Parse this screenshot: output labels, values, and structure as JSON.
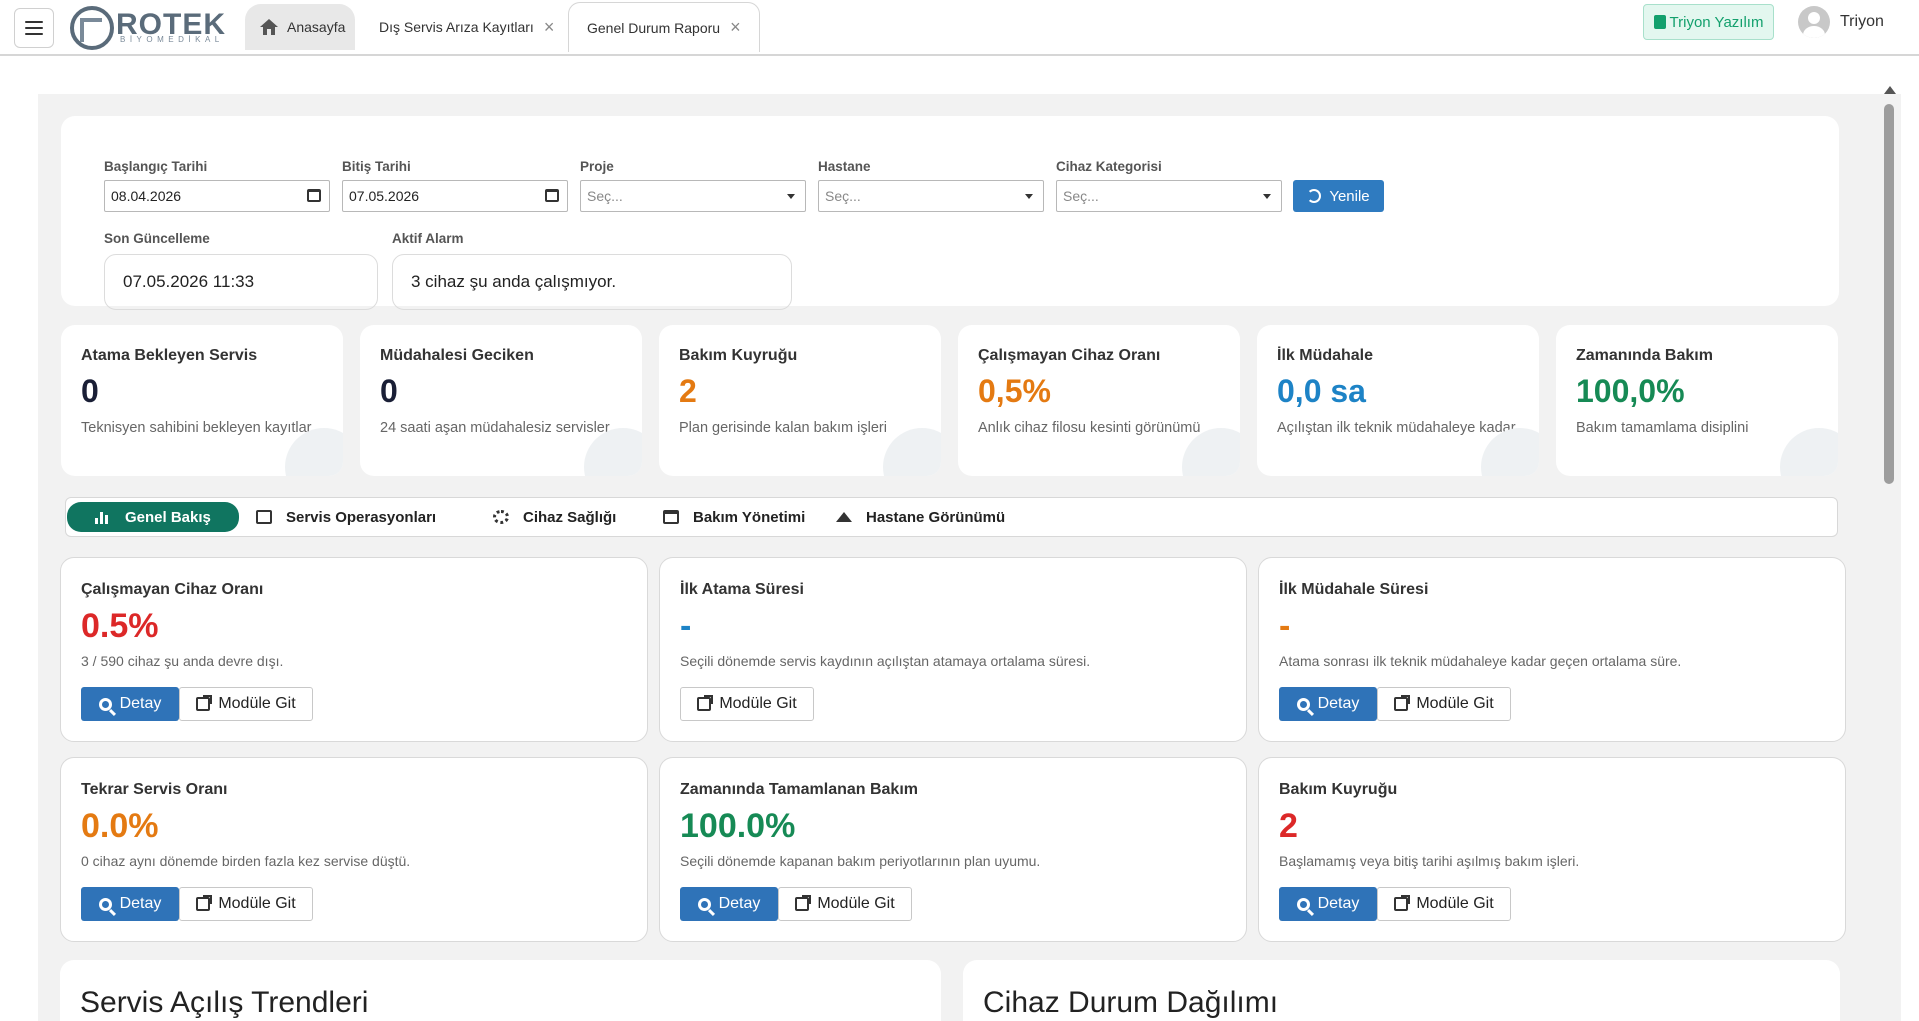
{
  "header": {
    "logo_text": "ROTEK",
    "logo_sub": "BİYOMEDİKAL",
    "tabs": [
      {
        "label": "Anasayfa"
      },
      {
        "label": "Dış Servis Arıza Kayıtları"
      },
      {
        "label": "Genel Durum Raporu"
      }
    ],
    "brand_button": "Triyon Yazılım",
    "user_name": "Triyon"
  },
  "filters": {
    "start_label": "Başlangıç Tarihi",
    "start_value": "08.04.2026",
    "end_label": "Bitiş Tarihi",
    "end_value": "07.05.2026",
    "project_label": "Proje",
    "project_placeholder": "Seç...",
    "hospital_label": "Hastane",
    "hospital_placeholder": "Seç...",
    "category_label": "Cihaz Kategorisi",
    "category_placeholder": "Seç...",
    "refresh_label": "Yenile",
    "last_update_label": "Son Güncelleme",
    "last_update_value": "07.05.2026 11:33",
    "alarm_label": "Aktif Alarm",
    "alarm_value": "3 cihaz şu anda çalışmıyor."
  },
  "kpis": [
    {
      "title": "Atama Bekleyen Servis",
      "value": "0",
      "desc": "Teknisyen sahibini bekleyen kayıtlar"
    },
    {
      "title": "Müdahalesi Geciken",
      "value": "0",
      "desc": "24 saati aşan müdahalesiz servisler"
    },
    {
      "title": "Bakım Kuyruğu",
      "value": "2",
      "desc": "Plan gerisinde kalan bakım işleri"
    },
    {
      "title": "Çalışmayan Cihaz Oranı",
      "value": "0,5%",
      "desc": "Anlık cihaz filosu kesinti görünümü"
    },
    {
      "title": "İlk Müdahale",
      "value": "0,0 sa",
      "desc": "Açılıştan ilk teknik müdahaleye kadar"
    },
    {
      "title": "Zamanında Bakım",
      "value": "100,0%",
      "desc": "Bakım tamamlama disiplini"
    }
  ],
  "section_tabs": [
    {
      "label": "Genel Bakış"
    },
    {
      "label": "Servis Operasyonları"
    },
    {
      "label": "Cihaz Sağlığı"
    },
    {
      "label": "Bakım Yönetimi"
    },
    {
      "label": "Hastane Görünümü"
    }
  ],
  "buttons": {
    "detay": "Detay",
    "git": "Modüle Git"
  },
  "metrics": [
    {
      "title": "Çalışmayan Cihaz Oranı",
      "value": "0.5%",
      "desc": "3 / 590 cihaz şu anda devre dışı."
    },
    {
      "title": "İlk Atama Süresi",
      "value": "-",
      "desc": "Seçili dönemde servis kaydının açılıştan atamaya ortalama süresi."
    },
    {
      "title": "İlk Müdahale Süresi",
      "value": "-",
      "desc": "Atama sonrası ilk teknik müdahaleye kadar geçen ortalama süre."
    },
    {
      "title": "Tekrar Servis Oranı",
      "value": "0.0%",
      "desc": "0 cihaz aynı dönemde birden fazla kez servise düştü."
    },
    {
      "title": "Zamanında Tamamlanan Bakım",
      "value": "100.0%",
      "desc": "Seçili dönemde kapanan bakım periyotlarının plan uyumu."
    },
    {
      "title": "Bakım Kuyruğu",
      "value": "2",
      "desc": "Başlamamış veya bitiş tarihi aşılmış bakım işleri."
    }
  ],
  "bottom": {
    "left_title": "Servis Açılış Trendleri",
    "right_title": "Cihaz Durum Dağılımı"
  },
  "colors": {
    "primary": "#2f73b8",
    "active_tab": "#107560",
    "orange": "#e47a12",
    "green": "#168a55",
    "red": "#dc2828",
    "blue": "#1d83c6"
  }
}
